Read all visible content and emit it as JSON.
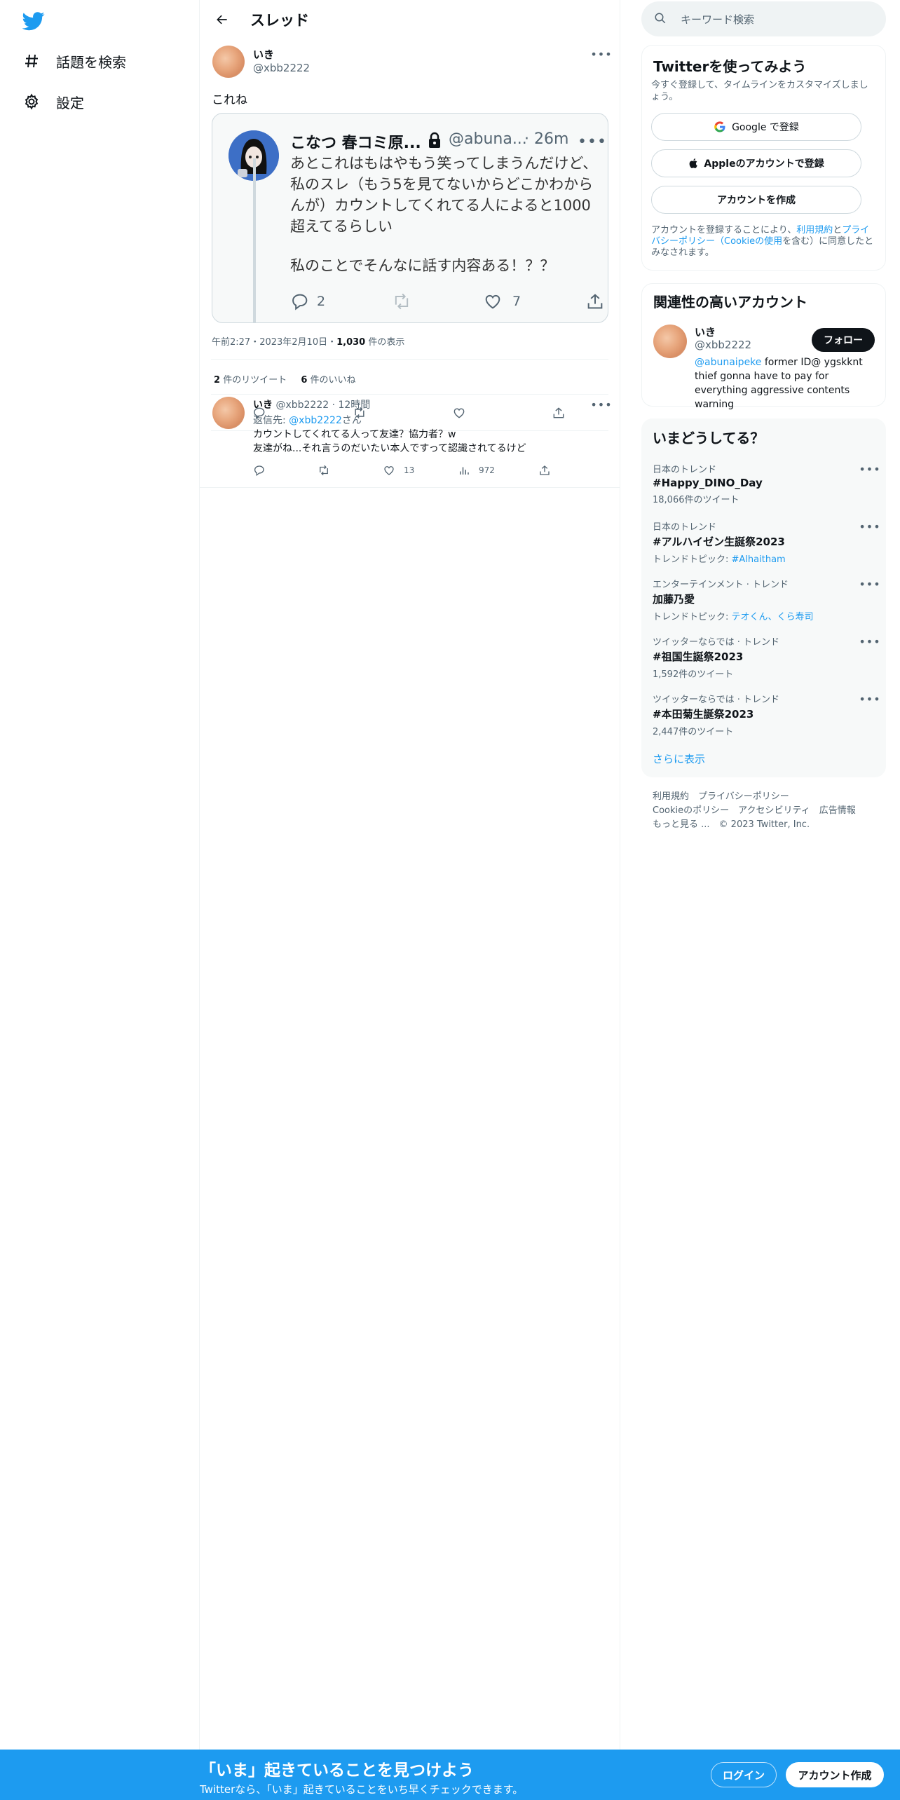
{
  "leftnav": {
    "items": [
      {
        "label": "話題を検索",
        "icon": "hashtag-icon"
      },
      {
        "label": "設定",
        "icon": "gear-icon"
      }
    ]
  },
  "header": {
    "title": "スレッド"
  },
  "tweet": {
    "name": "いき",
    "handle": "@xbb2222",
    "text": "これね",
    "timestamp": "午前2:27・2023年2月10日・",
    "views": "1,030",
    "views_label": "件の表示",
    "retweets": "2",
    "retweets_label": "件のリツイート",
    "likes": "6",
    "likes_label": "件のいいね"
  },
  "quote": {
    "name": "こなつ 春コミ原...",
    "handle": "@abuna...",
    "time": "· 26m",
    "text1": "あとこれはもはやもう笑ってしまうんだけど、私のスレ（もう5を見てないからどこかわからんが）カウントしてくれてる人によると1000超えてるらしい",
    "text2": "私のことでそんなに話す内容ある！？？",
    "reply_count": "2",
    "like_count": "7"
  },
  "reply": {
    "name": "いき",
    "handle": "@xbb2222",
    "time": "· 12時間",
    "reply_to_prefix": "返信先:",
    "reply_to_handle": "@xbb2222",
    "reply_to_suffix": "さん",
    "line1": "カウントしてくれてる人って友達？協力者？w",
    "line2": "友達がね...それ言うのだいたい本人ですって認識されてるけど",
    "likes": "13",
    "views": "972"
  },
  "right": {
    "search_placeholder": "キーワード検索",
    "signup": {
      "title": "Twitterを使ってみよう",
      "subtitle": "今すぐ登録して、タイムラインをカスタマイズしましょう。",
      "google": "Google で登録",
      "apple": "Appleのアカウントで登録",
      "create": "アカウントを作成",
      "terms_a": "アカウントを登録することにより、",
      "terms_link1": "利用規約",
      "terms_b": "と",
      "terms_link2": "プライバシーポリシー（Cookieの使用",
      "terms_c": "を含む）に同意したとみなされます。"
    },
    "related": {
      "title": "関連性の高いアカウント",
      "name": "いき",
      "handle": "@xbb2222",
      "follow": "フォロー",
      "bio_link": "@abunaipeke",
      "bio_text": " former ID@ ygskknt thief gonna have to pay for everything aggressive contents warning"
    },
    "trends": {
      "title": "いまどうしてる？",
      "items": [
        {
          "cat": "日本のトレンド",
          "name": "#Happy_DINO_Day",
          "sub": "18,066件のツイート",
          "sub_link": ""
        },
        {
          "cat": "日本のトレンド",
          "name": "#アルハイゼン生誕祭2023",
          "sub": "トレンドトピック: ",
          "sub_link": "#Alhaitham"
        },
        {
          "cat": "エンターテインメント · トレンド",
          "name": "加藤乃愛",
          "sub": "トレンドトピック: ",
          "sub_link": "テオくん、くら寿司"
        },
        {
          "cat": "ツイッターならでは · トレンド",
          "name": "#祖国生誕祭2023",
          "sub": "1,592件のツイート",
          "sub_link": ""
        },
        {
          "cat": "ツイッターならでは · トレンド",
          "name": "#本田菊生誕祭2023",
          "sub": "2,447件のツイート",
          "sub_link": ""
        }
      ],
      "show_more": "さらに表示"
    },
    "footer": {
      "line1": "利用規約　プライバシーポリシー",
      "line2": "Cookieのポリシー　アクセシビリティ　広告情報",
      "more": "もっと見る ...",
      "copyright": "© 2023 Twitter, Inc."
    }
  },
  "banner": {
    "title": "「いま」起きていることを見つけよう",
    "subtitle": "Twitterなら、「いま」起きていることをいち早くチェックできます。",
    "login": "ログイン",
    "signup": "アカウント作成"
  },
  "colors": {
    "brand": "#1d9bf0",
    "text": "#0f1419",
    "secondary": "#536471"
  }
}
